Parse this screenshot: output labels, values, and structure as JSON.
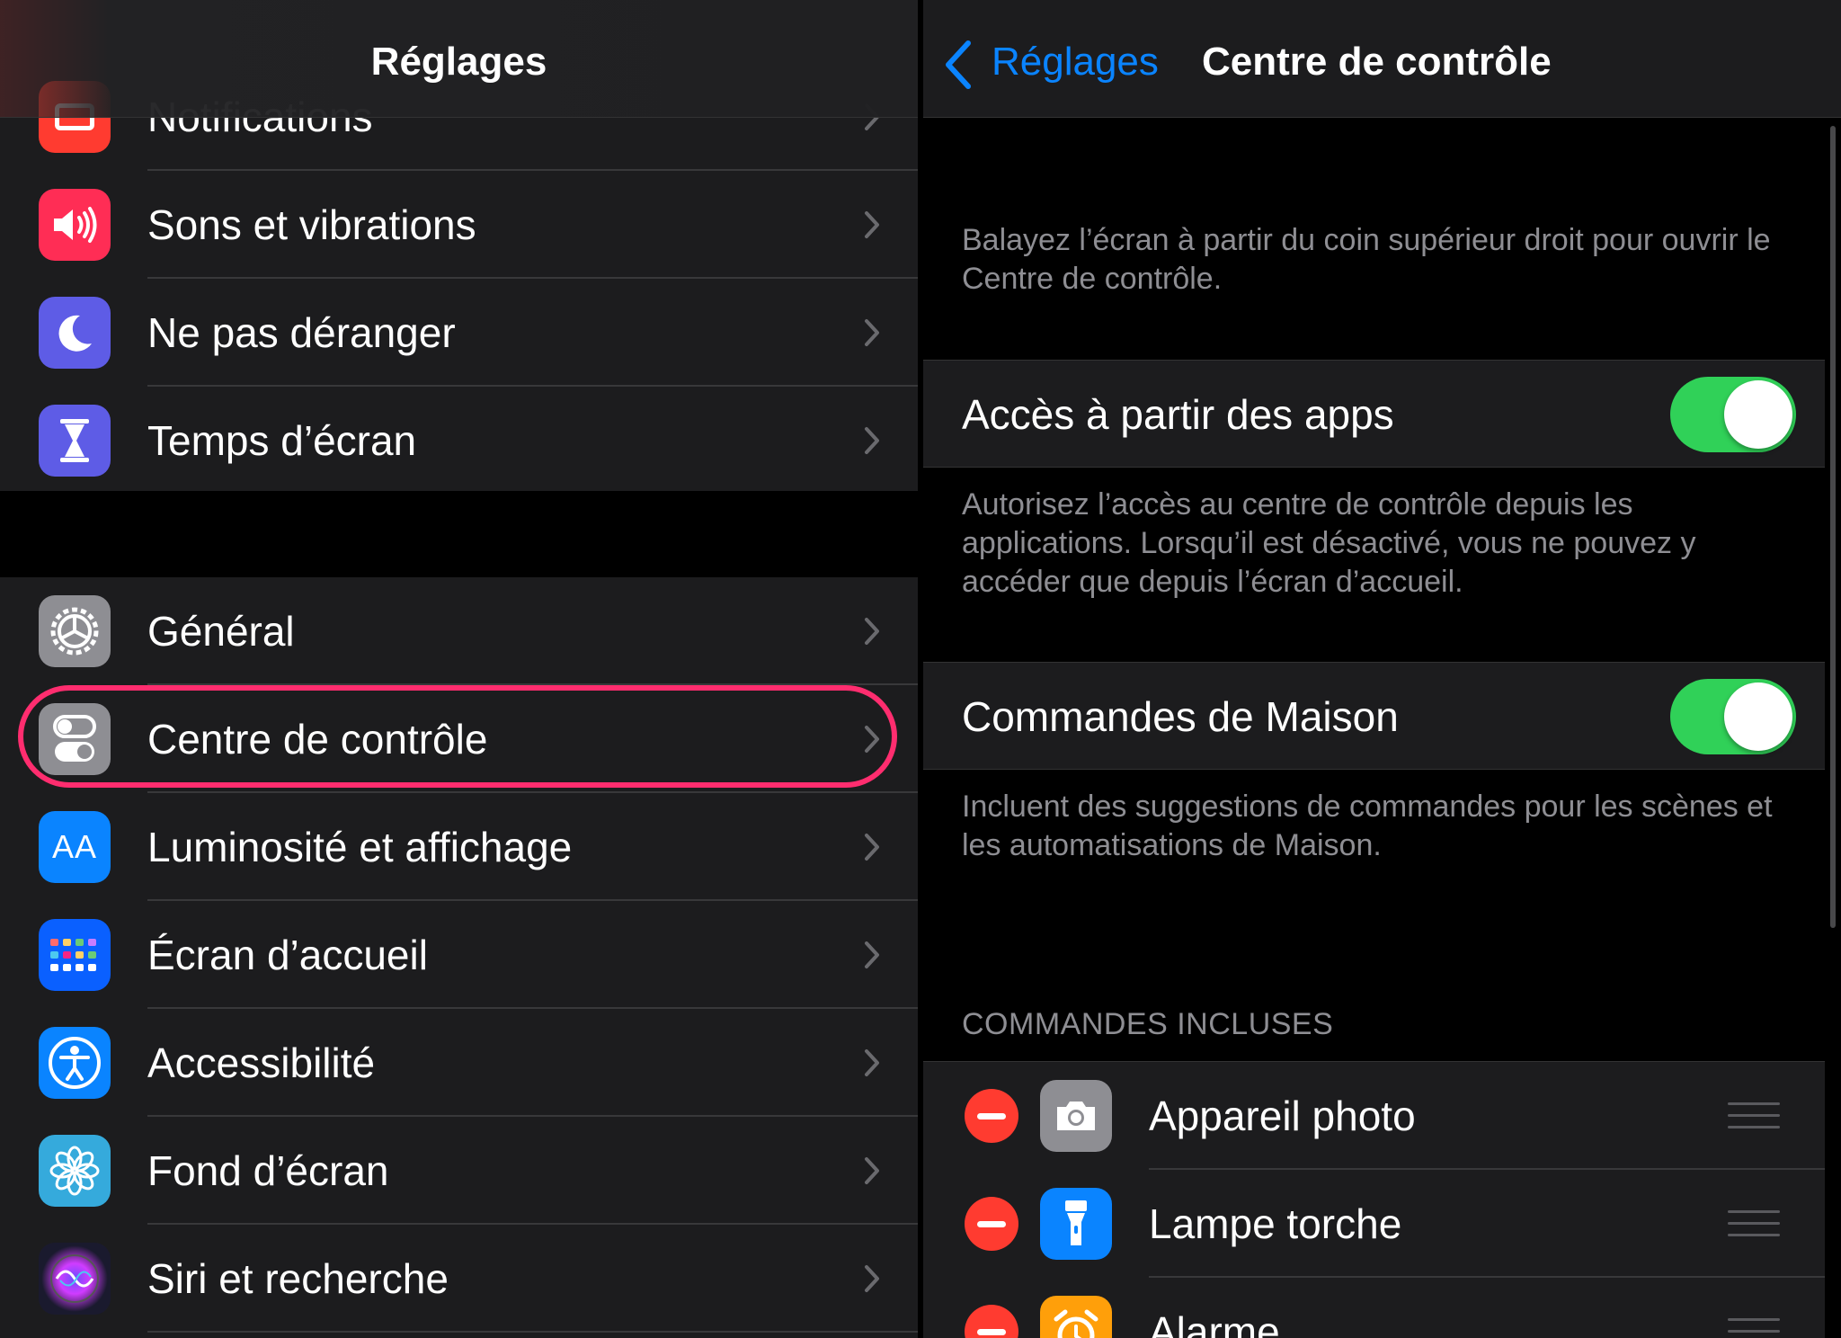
{
  "left": {
    "title": "Réglages",
    "partial_item": "Notifications",
    "group1": [
      {
        "label": "Sons et vibrations",
        "icon": "speaker-icon",
        "color": "#ff2d55"
      },
      {
        "label": "Ne pas déranger",
        "icon": "moon-icon",
        "color": "#5e5ce6"
      },
      {
        "label": "Temps d’écran",
        "icon": "hourglass-icon",
        "color": "#5e5ce6"
      }
    ],
    "group2": [
      {
        "label": "Général",
        "icon": "gear-icon",
        "color": "#8e8e93"
      },
      {
        "label": "Centre de contrôle",
        "icon": "switches-icon",
        "color": "#8e8e93",
        "highlighted": true
      },
      {
        "label": "Luminosité et affichage",
        "icon": "text-size-icon",
        "color": "#0a84ff",
        "icon_text": "AA"
      },
      {
        "label": "Écran d’accueil",
        "icon": "home-grid-icon",
        "color": "#0a60ff"
      },
      {
        "label": "Accessibilité",
        "icon": "accessibility-icon",
        "color": "#0a84ff"
      },
      {
        "label": "Fond d’écran",
        "icon": "flower-icon",
        "color": "#35aadc"
      },
      {
        "label": "Siri et recherche",
        "icon": "siri-icon",
        "color": "#1a1a2e"
      }
    ],
    "highlight_color": "#ff2d6f"
  },
  "right": {
    "back_label": "Réglages",
    "title": "Centre de contrôle",
    "intro": "Balayez l’écran à partir du coin supérieur droit pour ouvrir le Centre de contrôle.",
    "toggle1": {
      "label": "Accès à partir des apps",
      "on": true
    },
    "toggle1_desc": "Autorisez l’accès au centre de contrôle depuis les applications. Lorsqu’il est désactivé, vous ne pouvez y accéder que depuis l’écran d’accueil.",
    "toggle2": {
      "label": "Commandes de Maison",
      "on": true
    },
    "toggle2_desc": "Incluent des suggestions de commandes pour les scènes et les automatisations de Maison.",
    "section_header": "COMMANDES INCLUSES",
    "controls": [
      {
        "label": "Appareil photo",
        "icon": "camera-icon",
        "color": "#8e8e93"
      },
      {
        "label": "Lampe torche",
        "icon": "flashlight-icon",
        "color": "#0a84ff"
      },
      {
        "label": "Alarme",
        "icon": "alarm-icon",
        "color": "#ff9f0a"
      }
    ],
    "toggle_color": "#30d158"
  }
}
